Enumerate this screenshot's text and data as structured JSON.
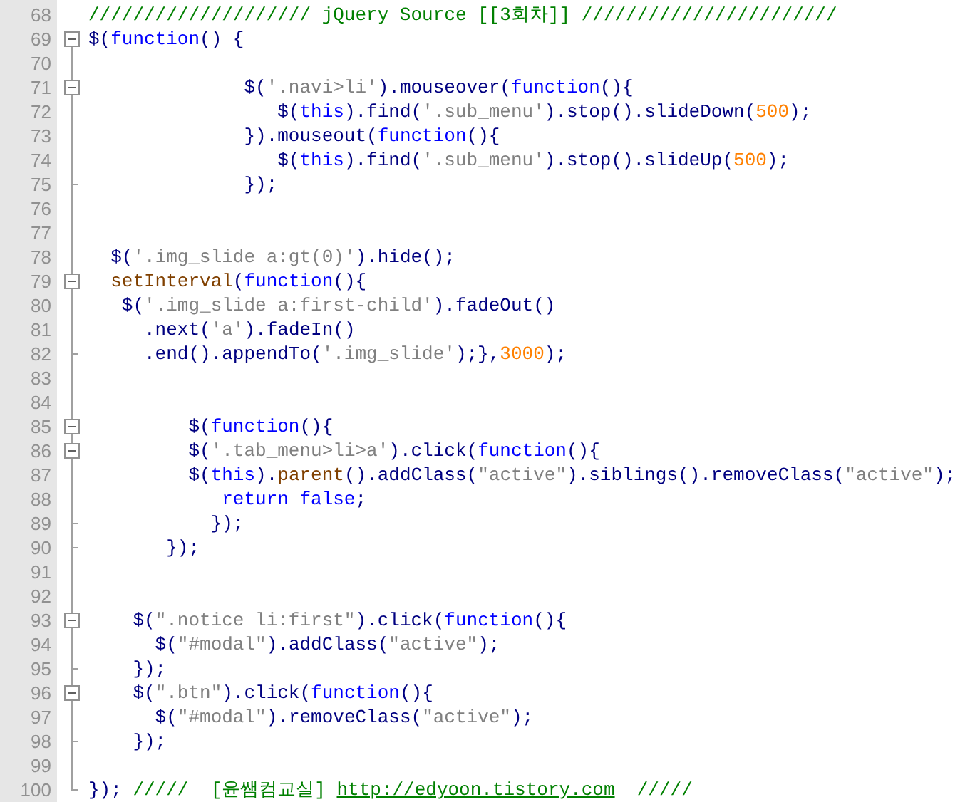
{
  "editor": {
    "lines": [
      {
        "number": "68",
        "fold_start": false,
        "fold_end": false,
        "tokens": [
          {
            "kind": "comment",
            "text": "//////////////////// jQuery Source [[3회차]] ///////////////////////"
          }
        ]
      },
      {
        "number": "69",
        "fold_start": true,
        "fold_end": false,
        "tokens": [
          {
            "kind": "plain",
            "text": "$("
          },
          {
            "kind": "keyword",
            "text": "function"
          },
          {
            "kind": "plain",
            "text": "() {"
          }
        ]
      },
      {
        "number": "70",
        "fold_start": false,
        "fold_end": false
      },
      {
        "number": "71",
        "fold_start": true,
        "fold_end": false,
        "tokens": [
          {
            "kind": "plain",
            "text": "              $("
          },
          {
            "kind": "string",
            "text": "'.navi>li'"
          },
          {
            "kind": "plain",
            "text": ").mouseover("
          },
          {
            "kind": "keyword",
            "text": "function"
          },
          {
            "kind": "plain",
            "text": "(){"
          }
        ]
      },
      {
        "number": "72",
        "fold_start": false,
        "fold_end": false,
        "tokens": [
          {
            "kind": "plain",
            "text": "                 $("
          },
          {
            "kind": "keyword",
            "text": "this"
          },
          {
            "kind": "plain",
            "text": ").find("
          },
          {
            "kind": "string",
            "text": "'.sub_menu'"
          },
          {
            "kind": "plain",
            "text": ").stop().slideDown("
          },
          {
            "kind": "number",
            "text": "500"
          },
          {
            "kind": "plain",
            "text": ");"
          }
        ]
      },
      {
        "number": "73",
        "fold_start": false,
        "fold_end": false,
        "tokens": [
          {
            "kind": "plain",
            "text": "              }).mouseout("
          },
          {
            "kind": "keyword",
            "text": "function"
          },
          {
            "kind": "plain",
            "text": "(){"
          }
        ]
      },
      {
        "number": "74",
        "fold_start": false,
        "fold_end": false,
        "tokens": [
          {
            "kind": "plain",
            "text": "                 $("
          },
          {
            "kind": "keyword",
            "text": "this"
          },
          {
            "kind": "plain",
            "text": ").find("
          },
          {
            "kind": "string",
            "text": "'.sub_menu'"
          },
          {
            "kind": "plain",
            "text": ").stop().slideUp("
          },
          {
            "kind": "number",
            "text": "500"
          },
          {
            "kind": "plain",
            "text": ");"
          }
        ]
      },
      {
        "number": "75",
        "fold_start": false,
        "fold_end": true,
        "tokens": [
          {
            "kind": "plain",
            "text": "              });"
          }
        ]
      },
      {
        "number": "76",
        "fold_start": false,
        "fold_end": false
      },
      {
        "number": "77",
        "fold_start": false,
        "fold_end": false
      },
      {
        "number": "78",
        "fold_start": false,
        "fold_end": false,
        "tokens": [
          {
            "kind": "plain",
            "text": "  $("
          },
          {
            "kind": "string",
            "text": "'.img_slide a:gt(0)'"
          },
          {
            "kind": "plain",
            "text": ").hide();"
          }
        ]
      },
      {
        "number": "79",
        "fold_start": true,
        "fold_end": false,
        "tokens": [
          {
            "kind": "function",
            "text": "  setInterval"
          },
          {
            "kind": "plain",
            "text": "("
          },
          {
            "kind": "keyword",
            "text": "function"
          },
          {
            "kind": "plain",
            "text": "(){"
          }
        ]
      },
      {
        "number": "80",
        "fold_start": false,
        "fold_end": false,
        "tokens": [
          {
            "kind": "plain",
            "text": "   $("
          },
          {
            "kind": "string",
            "text": "'.img_slide a:first-child'"
          },
          {
            "kind": "plain",
            "text": ").fadeOut()"
          }
        ]
      },
      {
        "number": "81",
        "fold_start": false,
        "fold_end": false,
        "tokens": [
          {
            "kind": "plain",
            "text": "     .next("
          },
          {
            "kind": "string",
            "text": "'a'"
          },
          {
            "kind": "plain",
            "text": ").fadeIn()"
          }
        ]
      },
      {
        "number": "82",
        "fold_start": false,
        "fold_end": true,
        "tokens": [
          {
            "kind": "plain",
            "text": "     .end().appendTo("
          },
          {
            "kind": "string",
            "text": "'.img_slide'"
          },
          {
            "kind": "plain",
            "text": ");},"
          },
          {
            "kind": "number",
            "text": "3000"
          },
          {
            "kind": "plain",
            "text": ");"
          }
        ]
      },
      {
        "number": "83",
        "fold_start": false,
        "fold_end": false
      },
      {
        "number": "84",
        "fold_start": false,
        "fold_end": false
      },
      {
        "number": "85",
        "fold_start": true,
        "fold_end": false,
        "tokens": [
          {
            "kind": "plain",
            "text": "         $("
          },
          {
            "kind": "keyword",
            "text": "function"
          },
          {
            "kind": "plain",
            "text": "(){"
          }
        ]
      },
      {
        "number": "86",
        "fold_start": true,
        "fold_end": false,
        "tokens": [
          {
            "kind": "plain",
            "text": "         $("
          },
          {
            "kind": "string",
            "text": "'.tab_menu>li>a'"
          },
          {
            "kind": "plain",
            "text": ").click("
          },
          {
            "kind": "keyword",
            "text": "function"
          },
          {
            "kind": "plain",
            "text": "(){"
          }
        ]
      },
      {
        "number": "87",
        "fold_start": false,
        "fold_end": false,
        "tokens": [
          {
            "kind": "plain",
            "text": "         $("
          },
          {
            "kind": "keyword",
            "text": "this"
          },
          {
            "kind": "plain",
            "text": ")."
          },
          {
            "kind": "function",
            "text": "parent"
          },
          {
            "kind": "plain",
            "text": "().addClass("
          },
          {
            "kind": "string",
            "text": "\"active\""
          },
          {
            "kind": "plain",
            "text": ").siblings().removeClass("
          },
          {
            "kind": "string",
            "text": "\"active\""
          },
          {
            "kind": "plain",
            "text": ");"
          }
        ]
      },
      {
        "number": "88",
        "fold_start": false,
        "fold_end": false,
        "tokens": [
          {
            "kind": "keyword",
            "text": "            return false"
          },
          {
            "kind": "plain",
            "text": ";"
          }
        ]
      },
      {
        "number": "89",
        "fold_start": false,
        "fold_end": true,
        "tokens": [
          {
            "kind": "plain",
            "text": "           });"
          }
        ]
      },
      {
        "number": "90",
        "fold_start": false,
        "fold_end": true,
        "tokens": [
          {
            "kind": "plain",
            "text": "       });"
          }
        ]
      },
      {
        "number": "91",
        "fold_start": false,
        "fold_end": false
      },
      {
        "number": "92",
        "fold_start": false,
        "fold_end": false
      },
      {
        "number": "93",
        "fold_start": true,
        "fold_end": false,
        "tokens": [
          {
            "kind": "plain",
            "text": "    $("
          },
          {
            "kind": "string",
            "text": "\".notice li:first\""
          },
          {
            "kind": "plain",
            "text": ").click("
          },
          {
            "kind": "keyword",
            "text": "function"
          },
          {
            "kind": "plain",
            "text": "(){"
          }
        ]
      },
      {
        "number": "94",
        "fold_start": false,
        "fold_end": false,
        "tokens": [
          {
            "kind": "plain",
            "text": "      $("
          },
          {
            "kind": "string",
            "text": "\"#modal\""
          },
          {
            "kind": "plain",
            "text": ").addClass("
          },
          {
            "kind": "string",
            "text": "\"active\""
          },
          {
            "kind": "plain",
            "text": ");"
          }
        ]
      },
      {
        "number": "95",
        "fold_start": false,
        "fold_end": true,
        "tokens": [
          {
            "kind": "plain",
            "text": "    });"
          }
        ]
      },
      {
        "number": "96",
        "fold_start": true,
        "fold_end": false,
        "tokens": [
          {
            "kind": "plain",
            "text": "    $("
          },
          {
            "kind": "string",
            "text": "\".btn\""
          },
          {
            "kind": "plain",
            "text": ").click("
          },
          {
            "kind": "keyword",
            "text": "function"
          },
          {
            "kind": "plain",
            "text": "(){"
          }
        ]
      },
      {
        "number": "97",
        "fold_start": false,
        "fold_end": false,
        "tokens": [
          {
            "kind": "plain",
            "text": "      $("
          },
          {
            "kind": "string",
            "text": "\"#modal\""
          },
          {
            "kind": "plain",
            "text": ").removeClass("
          },
          {
            "kind": "string",
            "text": "\"active\""
          },
          {
            "kind": "plain",
            "text": ");"
          }
        ]
      },
      {
        "number": "98",
        "fold_start": false,
        "fold_end": true,
        "tokens": [
          {
            "kind": "plain",
            "text": "    });"
          }
        ]
      },
      {
        "number": "99",
        "fold_start": false,
        "fold_end": false
      },
      {
        "number": "100",
        "fold_start": false,
        "fold_end": true,
        "tokens": [
          {
            "kind": "plain",
            "text": "});"
          },
          {
            "kind": "comment",
            "text": " /////  [윤쌤컴교실] "
          },
          {
            "kind": "link",
            "text": "http://edyoon.tistory.com"
          },
          {
            "kind": "comment",
            "text": "  /////"
          }
        ]
      }
    ]
  }
}
